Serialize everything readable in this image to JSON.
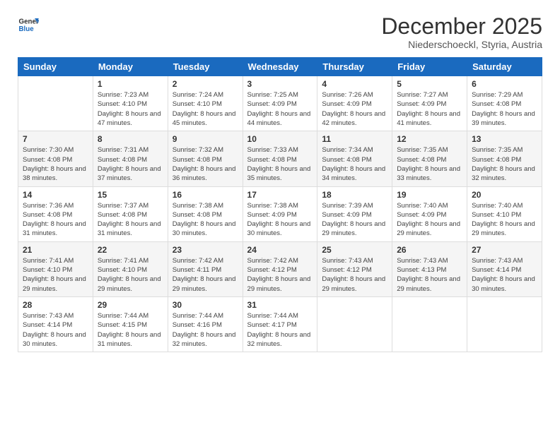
{
  "logo": {
    "line1": "General",
    "line2": "Blue"
  },
  "title": "December 2025",
  "subtitle": "Niederschoeckl, Styria, Austria",
  "days_of_week": [
    "Sunday",
    "Monday",
    "Tuesday",
    "Wednesday",
    "Thursday",
    "Friday",
    "Saturday"
  ],
  "weeks": [
    [
      {
        "day": "",
        "sunrise": "",
        "sunset": "",
        "daylight": ""
      },
      {
        "day": "1",
        "sunrise": "7:23 AM",
        "sunset": "4:10 PM",
        "daylight": "8 hours and 47 minutes."
      },
      {
        "day": "2",
        "sunrise": "7:24 AM",
        "sunset": "4:10 PM",
        "daylight": "8 hours and 45 minutes."
      },
      {
        "day": "3",
        "sunrise": "7:25 AM",
        "sunset": "4:09 PM",
        "daylight": "8 hours and 44 minutes."
      },
      {
        "day": "4",
        "sunrise": "7:26 AM",
        "sunset": "4:09 PM",
        "daylight": "8 hours and 42 minutes."
      },
      {
        "day": "5",
        "sunrise": "7:27 AM",
        "sunset": "4:09 PM",
        "daylight": "8 hours and 41 minutes."
      },
      {
        "day": "6",
        "sunrise": "7:29 AM",
        "sunset": "4:08 PM",
        "daylight": "8 hours and 39 minutes."
      }
    ],
    [
      {
        "day": "7",
        "sunrise": "7:30 AM",
        "sunset": "4:08 PM",
        "daylight": "8 hours and 38 minutes."
      },
      {
        "day": "8",
        "sunrise": "7:31 AM",
        "sunset": "4:08 PM",
        "daylight": "8 hours and 37 minutes."
      },
      {
        "day": "9",
        "sunrise": "7:32 AM",
        "sunset": "4:08 PM",
        "daylight": "8 hours and 36 minutes."
      },
      {
        "day": "10",
        "sunrise": "7:33 AM",
        "sunset": "4:08 PM",
        "daylight": "8 hours and 35 minutes."
      },
      {
        "day": "11",
        "sunrise": "7:34 AM",
        "sunset": "4:08 PM",
        "daylight": "8 hours and 34 minutes."
      },
      {
        "day": "12",
        "sunrise": "7:35 AM",
        "sunset": "4:08 PM",
        "daylight": "8 hours and 33 minutes."
      },
      {
        "day": "13",
        "sunrise": "7:35 AM",
        "sunset": "4:08 PM",
        "daylight": "8 hours and 32 minutes."
      }
    ],
    [
      {
        "day": "14",
        "sunrise": "7:36 AM",
        "sunset": "4:08 PM",
        "daylight": "8 hours and 31 minutes."
      },
      {
        "day": "15",
        "sunrise": "7:37 AM",
        "sunset": "4:08 PM",
        "daylight": "8 hours and 31 minutes."
      },
      {
        "day": "16",
        "sunrise": "7:38 AM",
        "sunset": "4:08 PM",
        "daylight": "8 hours and 30 minutes."
      },
      {
        "day": "17",
        "sunrise": "7:38 AM",
        "sunset": "4:09 PM",
        "daylight": "8 hours and 30 minutes."
      },
      {
        "day": "18",
        "sunrise": "7:39 AM",
        "sunset": "4:09 PM",
        "daylight": "8 hours and 29 minutes."
      },
      {
        "day": "19",
        "sunrise": "7:40 AM",
        "sunset": "4:09 PM",
        "daylight": "8 hours and 29 minutes."
      },
      {
        "day": "20",
        "sunrise": "7:40 AM",
        "sunset": "4:10 PM",
        "daylight": "8 hours and 29 minutes."
      }
    ],
    [
      {
        "day": "21",
        "sunrise": "7:41 AM",
        "sunset": "4:10 PM",
        "daylight": "8 hours and 29 minutes."
      },
      {
        "day": "22",
        "sunrise": "7:41 AM",
        "sunset": "4:10 PM",
        "daylight": "8 hours and 29 minutes."
      },
      {
        "day": "23",
        "sunrise": "7:42 AM",
        "sunset": "4:11 PM",
        "daylight": "8 hours and 29 minutes."
      },
      {
        "day": "24",
        "sunrise": "7:42 AM",
        "sunset": "4:12 PM",
        "daylight": "8 hours and 29 minutes."
      },
      {
        "day": "25",
        "sunrise": "7:43 AM",
        "sunset": "4:12 PM",
        "daylight": "8 hours and 29 minutes."
      },
      {
        "day": "26",
        "sunrise": "7:43 AM",
        "sunset": "4:13 PM",
        "daylight": "8 hours and 29 minutes."
      },
      {
        "day": "27",
        "sunrise": "7:43 AM",
        "sunset": "4:14 PM",
        "daylight": "8 hours and 30 minutes."
      }
    ],
    [
      {
        "day": "28",
        "sunrise": "7:43 AM",
        "sunset": "4:14 PM",
        "daylight": "8 hours and 30 minutes."
      },
      {
        "day": "29",
        "sunrise": "7:44 AM",
        "sunset": "4:15 PM",
        "daylight": "8 hours and 31 minutes."
      },
      {
        "day": "30",
        "sunrise": "7:44 AM",
        "sunset": "4:16 PM",
        "daylight": "8 hours and 32 minutes."
      },
      {
        "day": "31",
        "sunrise": "7:44 AM",
        "sunset": "4:17 PM",
        "daylight": "8 hours and 32 minutes."
      },
      {
        "day": "",
        "sunrise": "",
        "sunset": "",
        "daylight": ""
      },
      {
        "day": "",
        "sunrise": "",
        "sunset": "",
        "daylight": ""
      },
      {
        "day": "",
        "sunrise": "",
        "sunset": "",
        "daylight": ""
      }
    ]
  ]
}
